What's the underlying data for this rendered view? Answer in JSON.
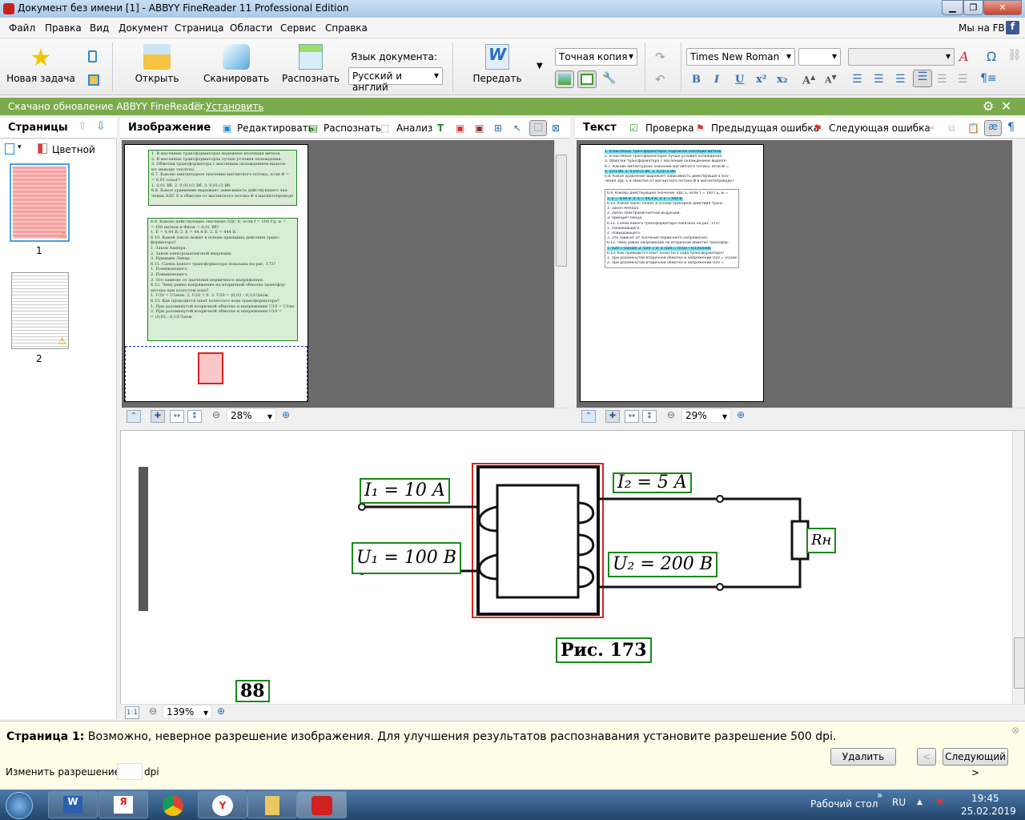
{
  "window": {
    "title": "Документ без имени [1] - ABBYY FineReader 11 Professional Edition",
    "controls": [
      "minimize",
      "restore",
      "close"
    ]
  },
  "menu": {
    "items": [
      "Файл",
      "Правка",
      "Вид",
      "Документ",
      "Страница",
      "Области",
      "Сервис",
      "Справка"
    ],
    "fb_label": "Мы на FB:"
  },
  "toolbar": {
    "new_task": "Новая задача",
    "open": "Открыть",
    "scan": "Сканировать",
    "recognize": "Распознать",
    "lang_label": "Язык документа:",
    "lang_value": "Русский и англий",
    "send": "Передать",
    "mode_value": "Точная копия",
    "font_value": "Times New Roman",
    "size_value": "",
    "style_value": ""
  },
  "notice": {
    "text": "Скачано обновление ABBYY FineReader.",
    "install": "Установить"
  },
  "pages_panel": {
    "title": "Страницы",
    "color_mode": "Цветной",
    "pages": [
      {
        "number": "1",
        "selected": true
      },
      {
        "number": "2",
        "selected": false
      }
    ]
  },
  "image_panel": {
    "title": "Изображение",
    "edit": "Редактировать",
    "recognize": "Распознать",
    "analyze": "Анализ",
    "zoom": "28%",
    "page_lines": [
      [
        "1. В масляных трансформаторах надежнее изоляция витков.",
        "2. В масляных трансформаторах лучше условия охлаждения.",
        "3. Обмотки трансформатора с масляным охлаждением выделя-",
        "ют меньше теплоты."
      ],
      [
        "6.7. Каково амплитудное значение магнитного потока, если Ф =",
        "= 0,01 cosωt?",
        "1. 0,01 Вб.      2. 0,01/√2 Вб.      3. 0,01√2 Вб."
      ],
      [
        "6.8. Какое уравнение выражает зависимость действующего зна-",
        "чения ЭДС E в обмотке от магнитного потока Ф в магнитопроводе?"
      ],
      [
        "6.9. Каково действующее значение ЭДС E, если f = 100 Гц, w =",
        "= 100 витков и Фmax = 0,01 Вб?",
        "1. E = 4,44 В.    2. E = 44,4 В.    3. E = 444 В.",
        "6.10. Какой закон лежит в основе принципа действия транс-",
        "форматора?",
        "1. Закон Ампера.",
        "2. Закон электромагнитной индукции.",
        "3. Принцип Ленца.",
        "6.11. Схема какого трансформатора показана на рис. 173?",
        "1. Понижающего.",
        "2. Повышающего.",
        "3. Это зависит от значения первичного напряжения.",
        "6.12. Чему равно напряжение на вторичной обмотке трансфор-",
        "матора при холостом ходе?",
        "1. U20 = U2ном.   2. U20 = 0.   3. U20 = (0,03 – 0,1)U2ном.",
        "6.13. Как проводится опыт холостого хода трансформатора?",
        "1. При разомкнутой вторичной обмотке и напряжении U10 = U1ном.",
        "2. При разомкнутой вторичной обмотке и напряжении U10 =",
        "= (0,03…0,1)U1ном."
      ]
    ]
  },
  "text_panel": {
    "title": "Текст",
    "check": "Проверка",
    "prev_error": "Предыдущая ошибка",
    "next_error": "Следующая ошибка",
    "zoom": "29%"
  },
  "zoom_panel": {
    "zoom": "139%",
    "one_to_one": "1:1",
    "labels": {
      "i1": "I₁ = 10 A",
      "i2": "I₂ = 5 A",
      "u1": "U₁ = 100 B",
      "u2": "U₂ = 200 B",
      "rn": "Rн",
      "caption": "Рис. 173",
      "page_number": "88"
    }
  },
  "warning": {
    "page_label": "Страница 1:",
    "message": "Возможно, неверное разрешение изображения. Для улучшения результатов распознавания установите разрешение 500 dpi.",
    "delete": "Удалить",
    "prev": "<",
    "next": "Следующий >",
    "change_label": "Изменить разрешение на:",
    "dpi_value": "",
    "dpi_unit": "dpi"
  },
  "taskbar": {
    "apps": [
      "Word",
      "Яндекс",
      "Chrome",
      "Яндекс.Браузер",
      "Проводник",
      "ABBYY FineReader"
    ],
    "desktop": "Рабочий стол",
    "lang": "RU",
    "time": "19:45",
    "date": "25.02.2019"
  },
  "colors": {
    "notice_bar": "#7bab4c",
    "region_green": "#1a8a1a",
    "selection_red": "#e02020",
    "ocr_highlight": "#6fe0ef",
    "warning_bg": "#fffde8"
  }
}
